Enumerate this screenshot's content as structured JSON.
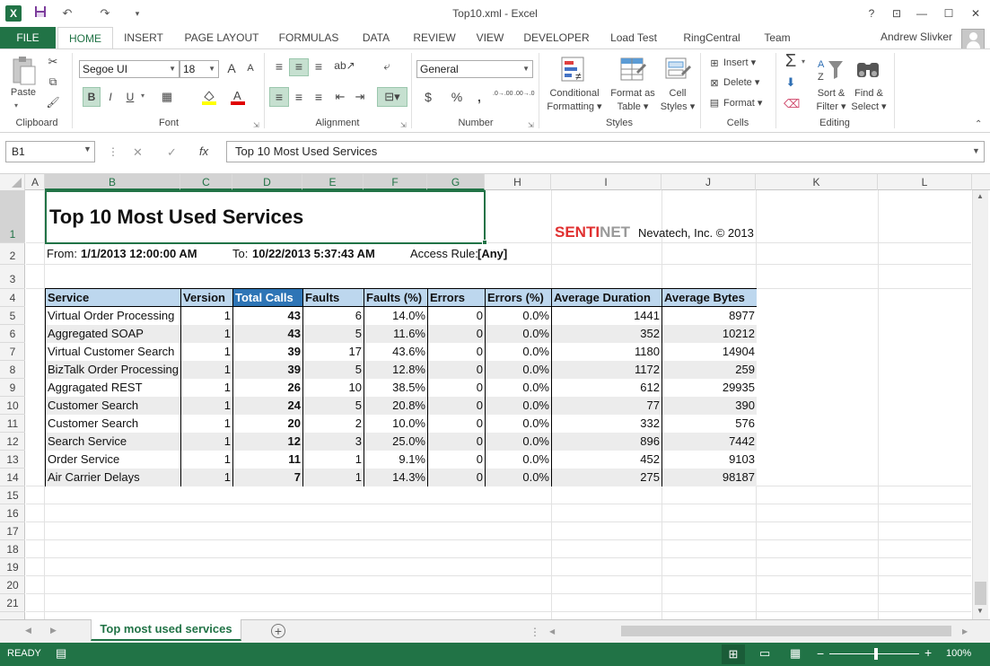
{
  "app": {
    "title": "Top10.xml - Excel",
    "user": "Andrew Slivker",
    "help": "?",
    "restore_ribbon": "⊡",
    "minimize": "—",
    "maximize": "☐",
    "close": "✕"
  },
  "tabs": {
    "file": "FILE",
    "home": "HOME",
    "insert": "INSERT",
    "page_layout": "PAGE LAYOUT",
    "formulas": "FORMULAS",
    "data": "DATA",
    "review": "REVIEW",
    "view": "VIEW",
    "developer": "DEVELOPER",
    "load_test": "Load Test",
    "ringcentral": "RingCentral",
    "team": "Team"
  },
  "ribbon": {
    "clipboard": {
      "label": "Clipboard",
      "paste": "Paste"
    },
    "font": {
      "label": "Font",
      "name": "Segoe UI",
      "size": "18",
      "grow": "A",
      "shrink": "A",
      "bold": "B",
      "italic": "I",
      "underline": "U"
    },
    "alignment": {
      "label": "Alignment"
    },
    "number": {
      "label": "Number",
      "format": "General",
      "currency": "$",
      "percent": "%",
      "comma": ",",
      "inc_dec": ".0→.00",
      "dec_dec": ".00→.0"
    },
    "styles": {
      "label": "Styles",
      "conditional": [
        "Conditional",
        "Formatting"
      ],
      "format_table": [
        "Format as",
        "Table"
      ],
      "cell_styles": [
        "Cell",
        "Styles"
      ]
    },
    "cells": {
      "label": "Cells",
      "insert": "Insert",
      "delete": "Delete",
      "format": "Format"
    },
    "editing": {
      "label": "Editing",
      "sum": "Σ",
      "sort": [
        "Sort &",
        "Filter"
      ],
      "find": [
        "Find &",
        "Select"
      ]
    }
  },
  "formula_bar": {
    "name_box": "B1",
    "fx": "fx",
    "cancel": "✕",
    "enter": "✓",
    "value": "Top 10 Most Used Services"
  },
  "columns": [
    "A",
    "B",
    "C",
    "D",
    "E",
    "F",
    "G",
    "H",
    "I",
    "J",
    "K",
    "L"
  ],
  "rows": [
    "1",
    "2",
    "3",
    "4",
    "5",
    "6",
    "7",
    "8",
    "9",
    "10",
    "11",
    "12",
    "13",
    "14",
    "15",
    "16",
    "17",
    "18",
    "19",
    "20",
    "21"
  ],
  "report": {
    "title": "Top 10 Most Used Services",
    "brand_red": "SENTI",
    "brand_gray": "NET",
    "company": "Nevatech, Inc. © 2013",
    "from_label": "From:",
    "from_value": "1/1/2013 12:00:00 AM",
    "to_label": "To:",
    "to_value": "10/22/2013 5:37:43 AM",
    "rule_label": "Access Rule:",
    "rule_value": "[Any]",
    "headers": [
      "Service",
      "Version",
      "Total Calls",
      "Faults",
      "Faults (%)",
      "Errors",
      "Errors (%)",
      "Average Duration",
      "Average Bytes"
    ],
    "data": [
      [
        "Virtual Order Processing",
        "1",
        "43",
        "6",
        "14.0%",
        "0",
        "0.0%",
        "1441",
        "8977"
      ],
      [
        "Aggregated SOAP",
        "1",
        "43",
        "5",
        "11.6%",
        "0",
        "0.0%",
        "352",
        "10212"
      ],
      [
        "Virtual Customer Search",
        "1",
        "39",
        "17",
        "43.6%",
        "0",
        "0.0%",
        "1180",
        "14904"
      ],
      [
        "BizTalk Order Processing",
        "1",
        "39",
        "5",
        "12.8%",
        "0",
        "0.0%",
        "1172",
        "259"
      ],
      [
        "Aggragated REST",
        "1",
        "26",
        "10",
        "38.5%",
        "0",
        "0.0%",
        "612",
        "29935"
      ],
      [
        "Customer Search",
        "1",
        "24",
        "5",
        "20.8%",
        "0",
        "0.0%",
        "77",
        "390"
      ],
      [
        "Customer Search",
        "1",
        "20",
        "2",
        "10.0%",
        "0",
        "0.0%",
        "332",
        "576"
      ],
      [
        "Search Service",
        "1",
        "12",
        "3",
        "25.0%",
        "0",
        "0.0%",
        "896",
        "7442"
      ],
      [
        "Order Service",
        "1",
        "11",
        "1",
        "9.1%",
        "0",
        "0.0%",
        "452",
        "9103"
      ],
      [
        "Air Carrier Delays",
        "1",
        "7",
        "1",
        "14.3%",
        "0",
        "0.0%",
        "275",
        "98187"
      ]
    ]
  },
  "sheet": {
    "tab": "Top most used services",
    "add": "+"
  },
  "status": {
    "mode": "READY",
    "zoom": "100%",
    "zoom_out": "−",
    "zoom_in": "+"
  },
  "colors": {
    "accent": "#217346",
    "header_fill": "#bdd7ee",
    "highlight_fill": "#2e75b6",
    "brand_red": "#e03030"
  }
}
